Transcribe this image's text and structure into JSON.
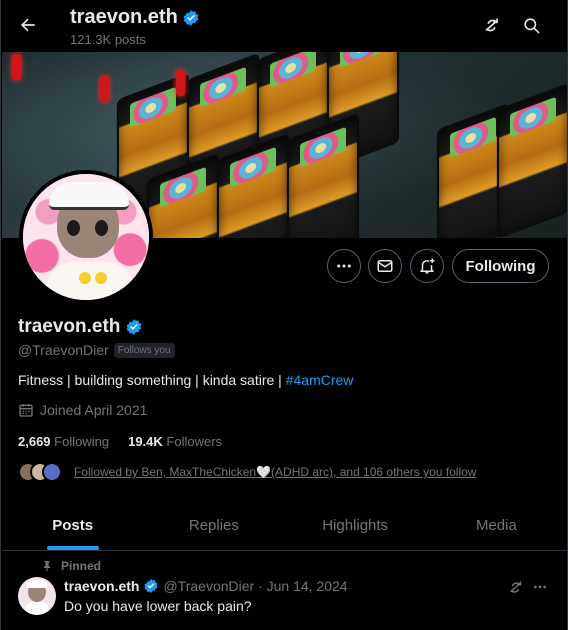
{
  "header": {
    "name": "traevon.eth",
    "posts_count": "121.3K posts"
  },
  "profile": {
    "name": "traevon.eth",
    "handle": "@TraevonDier",
    "follows_you": "Follows you",
    "bio_text": "Fitness | building something | kinda satire | ",
    "bio_hashtag": "#4amCrew",
    "joined": "Joined April 2021",
    "following_count": "2,669",
    "following_label": "Following",
    "followers_count": "19.4K",
    "followers_label": "Followers",
    "mutuals_text": "Followed by Ben, MaxTheChicken🤍(ADHD arc), and 106 others you follow"
  },
  "actions": {
    "following_button": "Following"
  },
  "tabs": [
    {
      "label": "Posts"
    },
    {
      "label": "Replies"
    },
    {
      "label": "Highlights"
    },
    {
      "label": "Media"
    }
  ],
  "pinned_post": {
    "pinned_label": "Pinned",
    "author": "traevon.eth",
    "handle_date": "@TraevonDier · Jun 14, 2024",
    "text": "Do you have lower back pain?"
  },
  "colors": {
    "accent": "#1d9bf0",
    "background": "#000000",
    "muted": "#71767b",
    "verified": "#1d9bf0"
  }
}
